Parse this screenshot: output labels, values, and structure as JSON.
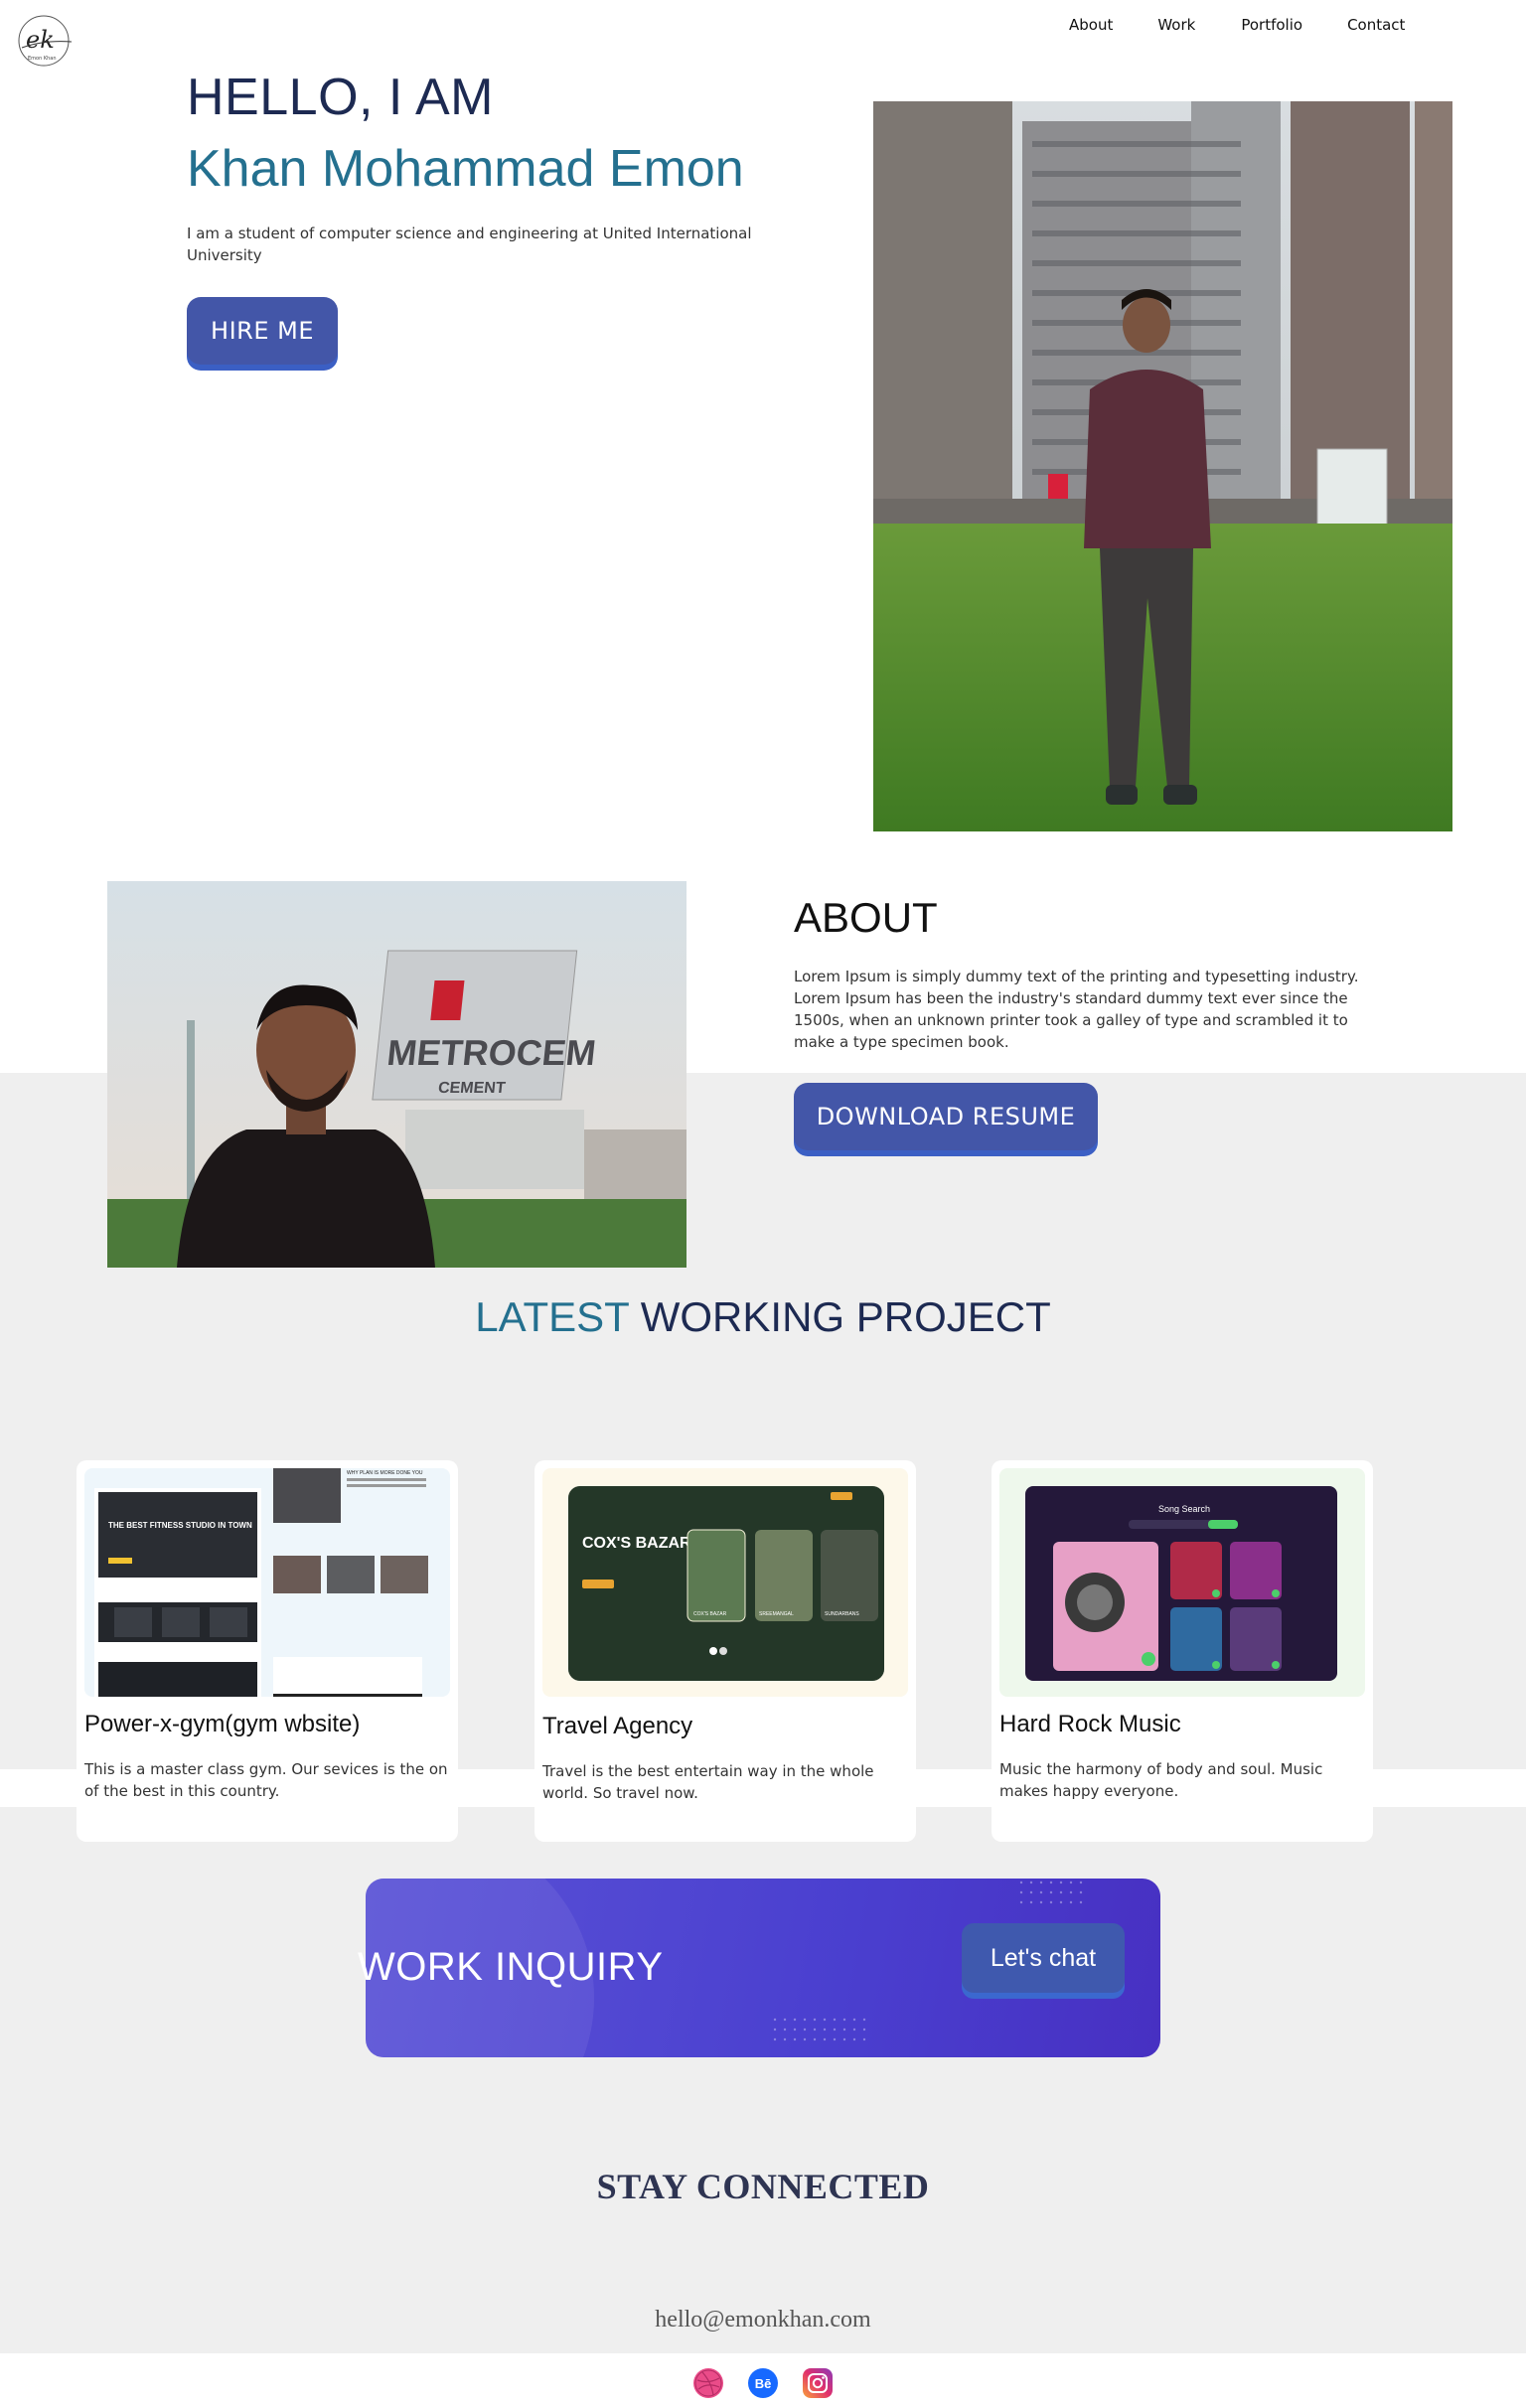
{
  "logo": {
    "monogram": "ek",
    "signature": "Emon Khan"
  },
  "nav": {
    "items": [
      "About",
      "Work",
      "Portfolio",
      "Contact"
    ]
  },
  "hero": {
    "greeting": "HELLO, I AM",
    "name": "Khan Mohammad Emon",
    "description": "I am a student of computer science and engineering at United International University",
    "cta": "HIRE ME"
  },
  "about": {
    "title": "ABOUT",
    "text": "Lorem Ipsum is simply dummy text of the printing and typesetting industry. Lorem Ipsum has been the industry's standard dummy text ever since the 1500s, when an unknown printer took a galley of type and scrambled it to make a type specimen book.",
    "cta": "DOWNLOAD RESUME",
    "sign_text": "METROCEM",
    "sign_sub": "CEMENT"
  },
  "projects": {
    "heading_accent": "LATEST",
    "heading_rest": "WORKING PROJECT",
    "cards": [
      {
        "title": "Power-x-gym(gym wbsite)",
        "desc": "This is a master class gym. Our sevices is the on of the best in this country.",
        "thumb_text": "THE BEST FITNESS STUDIO IN TOWN",
        "thumb_side": "WHY PLAN IS MORE DONE YOU"
      },
      {
        "title": "Travel Agency",
        "desc": "Travel is the best entertain way in the whole world. So travel now.",
        "thumb_text": "COX'S BAZAR",
        "thumb_chips": [
          "COX'S BAZAR",
          "SREEMANGAL",
          "SUNDARBANS"
        ]
      },
      {
        "title": "Hard Rock Music",
        "desc": "Music the harmony of body and soul. Music makes happy everyone.",
        "thumb_text": "Song Search"
      }
    ]
  },
  "inquiry": {
    "title": "WORK INQUIRY",
    "cta": "Let's chat"
  },
  "footer": {
    "heading": "STAY CONNECTED",
    "email": "hello@emonkhan.com",
    "social": [
      {
        "name": "dribbble",
        "color": "#ea4c89"
      },
      {
        "name": "behance",
        "color": "#1769ff",
        "glyph": "Bē"
      },
      {
        "name": "instagram",
        "color": "#c13584"
      }
    ]
  },
  "colors": {
    "navy": "#1d2a52",
    "teal": "#24708f",
    "button": "#4356a8",
    "inquiry": "#4a3fcf"
  }
}
